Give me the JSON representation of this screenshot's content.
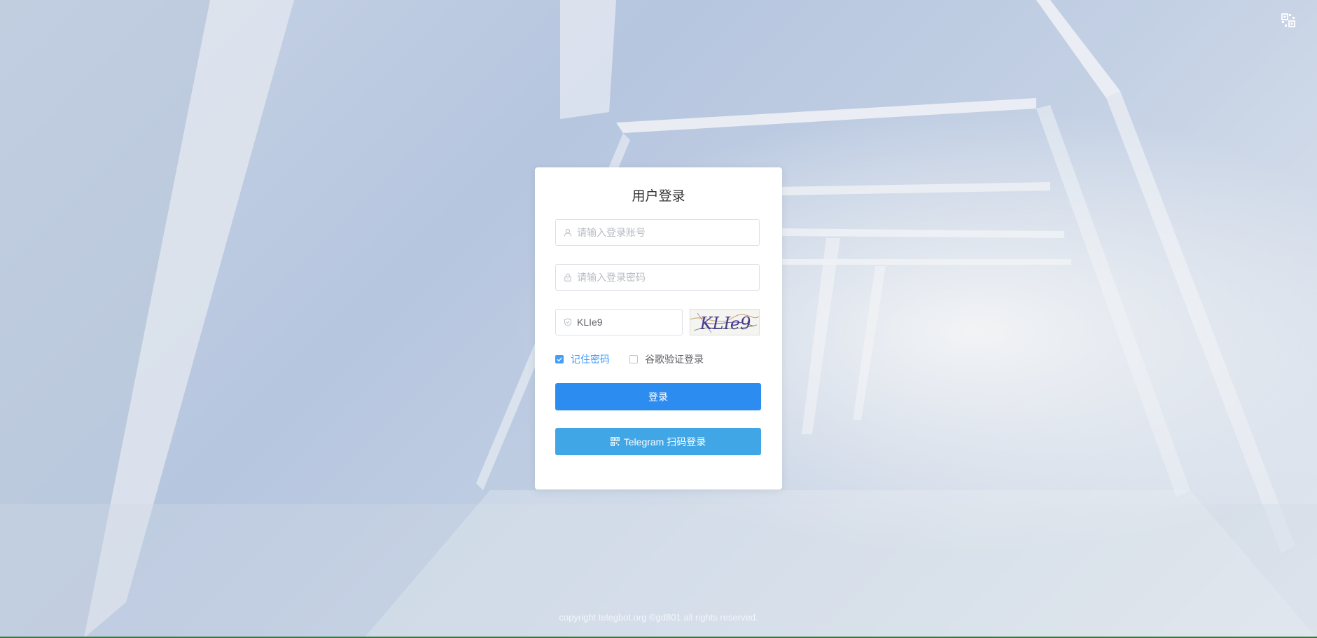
{
  "login": {
    "title": "用户登录",
    "username_placeholder": "请输入登录账号",
    "password_placeholder": "请输入登录密码",
    "captcha_value": "KLIe9",
    "captcha_image_text": "KLIe9",
    "remember_label": "记住密码",
    "remember_checked": true,
    "google_label": "谷歌验证登录",
    "google_checked": false,
    "login_button": "登录",
    "telegram_button": "Telegram 扫码登录"
  },
  "footer": {
    "copyright": "copyright telegbot.org ©gd801 all rights reserved."
  },
  "icons": {
    "top_right": "qrcode-switch-icon",
    "username": "user-icon",
    "password": "lock-icon",
    "captcha": "shield-icon",
    "telegram": "qrcode-icon"
  },
  "colors": {
    "primary": "#2d8cf0",
    "telegram": "#40a6e6",
    "checkbox_active": "#409eff"
  }
}
